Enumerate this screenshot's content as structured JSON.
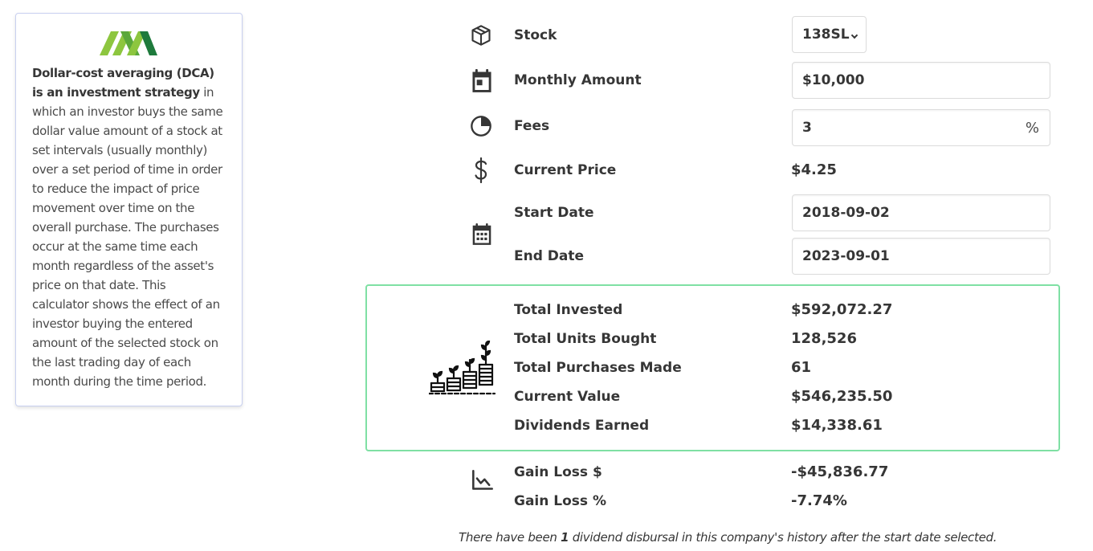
{
  "info": {
    "bold_intro": "Dollar-cost averaging (DCA) is an investment strategy",
    "text": " in which an investor buys the same dollar value amount of a stock at set intervals (usually monthly) over a set period of time in order to reduce the impact of price movement over time on the overall purchase. The purchases occur at the same time each month regardless of the asset's price on that date. This calculator shows the effect of an investor buying the entered amount of the selected stock on the last trading day of each month during the time period."
  },
  "form": {
    "stock_label": "Stock",
    "stock_value": "138SL",
    "monthly_label": "Monthly Amount",
    "monthly_value": "$10,000",
    "fees_label": "Fees",
    "fees_value": "3",
    "fees_suffix": "%",
    "price_label": "Current Price",
    "price_value": "$4.25",
    "start_label": "Start Date",
    "start_value": "2018-09-02",
    "end_label": "End Date",
    "end_value": "2023-09-01"
  },
  "results": {
    "invested_label": "Total Invested",
    "invested_value": "$592,072.27",
    "units_label": "Total Units Bought",
    "units_value": "128,526",
    "purchases_label": "Total Purchases Made",
    "purchases_value": "61",
    "current_label": "Current Value",
    "current_value": "$546,235.50",
    "dividends_label": "Dividends Earned",
    "dividends_value": "$14,338.61"
  },
  "gain": {
    "dollar_label": "Gain Loss $",
    "dollar_value": "-$45,836.77",
    "pct_label": "Gain Loss %",
    "pct_value": "-7.74%"
  },
  "footnote": {
    "before": "There have been ",
    "count": "1",
    "after": " dividend disbursal in this company's history after the start date selected."
  },
  "colors": {
    "logo_light": "#8dc63f",
    "logo_dark": "#1e7a3c",
    "results_border": "#7fe0a4"
  }
}
